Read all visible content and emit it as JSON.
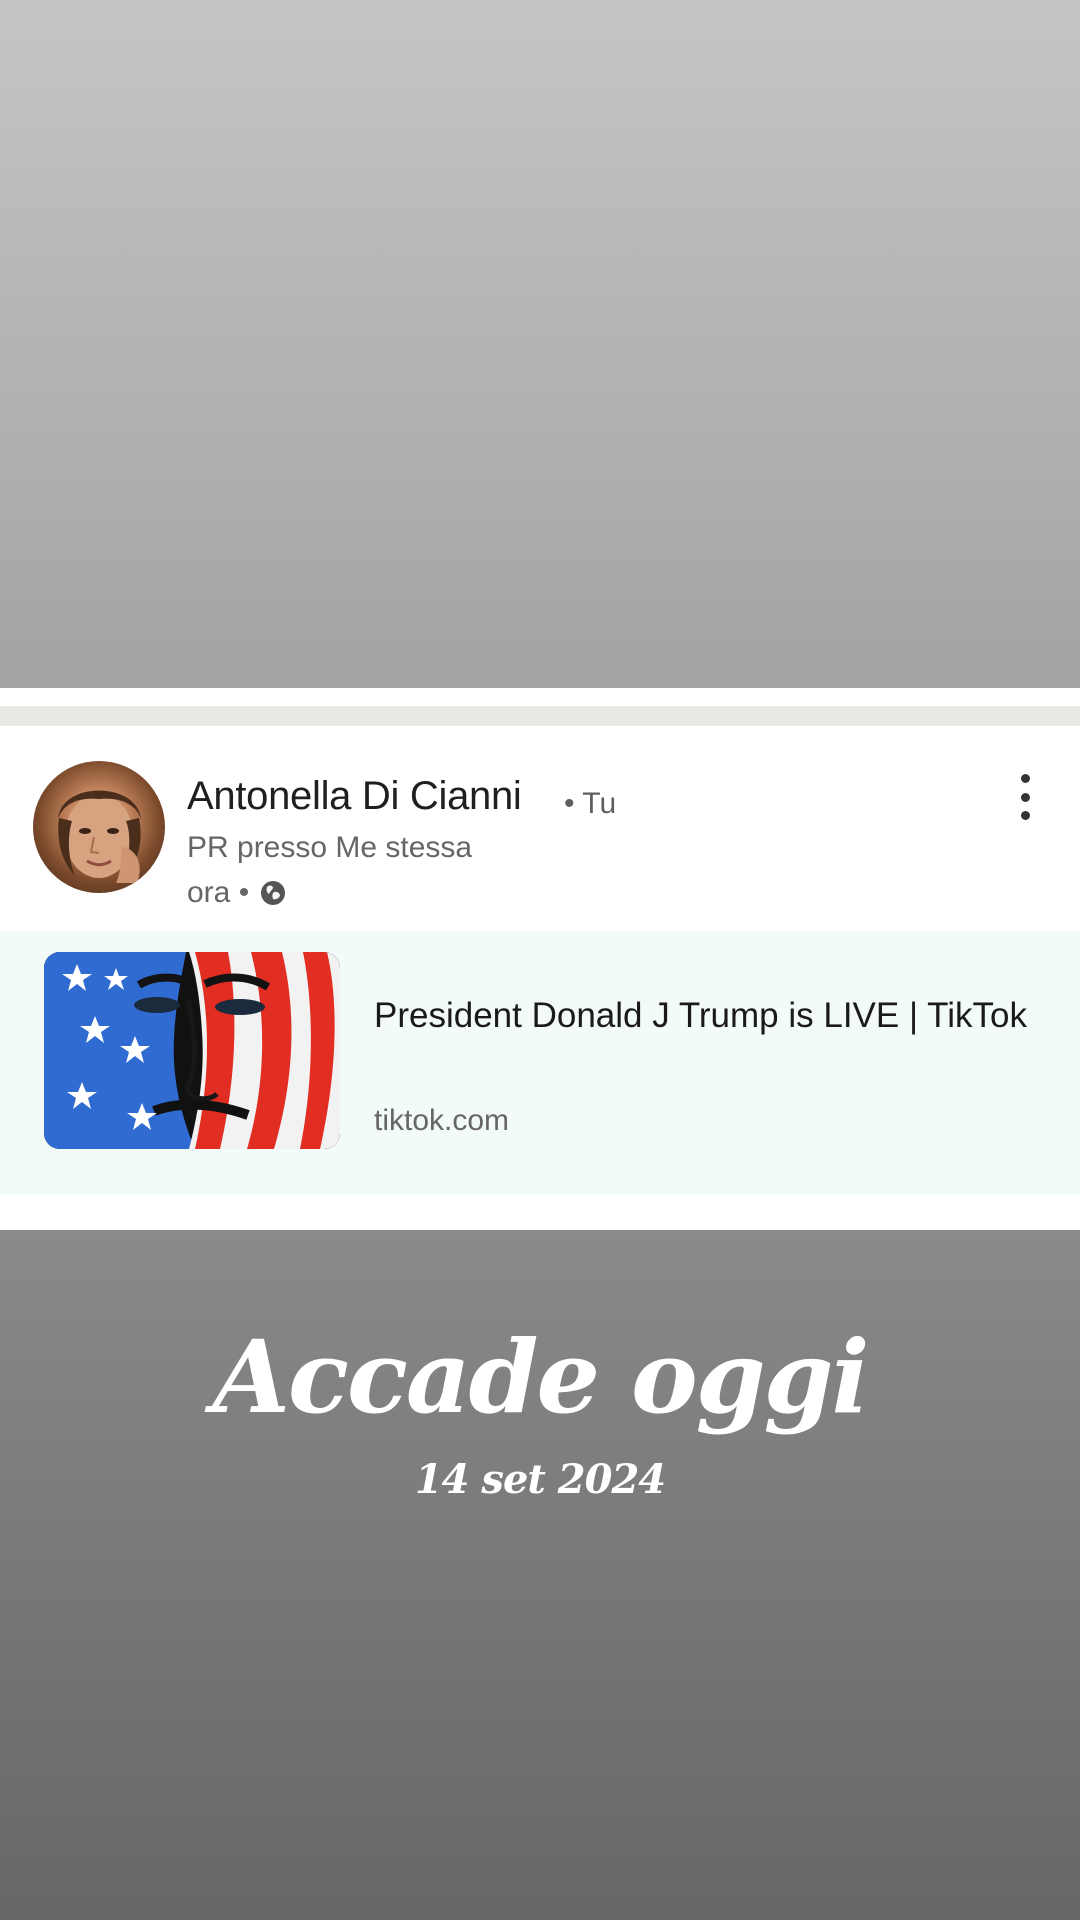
{
  "post": {
    "author_name": "Antonella Di Cianni",
    "author_relation": "• Tu",
    "author_headline": "PR presso Me stessa",
    "time": "ora •",
    "visibility_icon": "globe-icon",
    "more_icon": "more-vertical-icon"
  },
  "link_preview": {
    "title": "President Donald J Trump is LIVE | TikTok",
    "domain": "tiktok.com",
    "thumbnail": "flag-painted-face-image"
  },
  "story": {
    "title": "Accade oggi",
    "date": "14 set 2024"
  },
  "colors": {
    "background_top": "#b4b4b4",
    "background_bottom": "#777777",
    "card": "#ffffff",
    "preview_background": "#f3fafa",
    "flag_blue": "#2f6bd0",
    "flag_red": "#e22d22"
  }
}
